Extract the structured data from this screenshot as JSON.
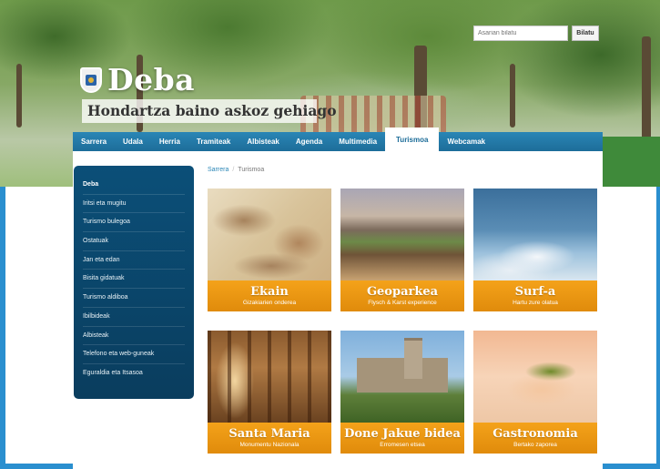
{
  "search": {
    "placeholder": "Asarian bilatu",
    "button_label": "Bilatu"
  },
  "logo": {
    "text": "Deba",
    "tagline": "Hondartza baino askoz gehiago"
  },
  "nav": {
    "items": [
      {
        "label": "Sarrera"
      },
      {
        "label": "Udala"
      },
      {
        "label": "Herria"
      },
      {
        "label": "Tramiteak"
      },
      {
        "label": "Albisteak"
      },
      {
        "label": "Agenda"
      },
      {
        "label": "Multimedia"
      },
      {
        "label": "Turismoa"
      },
      {
        "label": "Webcamak"
      }
    ],
    "active": "Turismoa"
  },
  "breadcrumb": {
    "home": "Sarrera",
    "current": "Turismoa"
  },
  "sidebar": {
    "items": [
      {
        "label": "Deba"
      },
      {
        "label": "Iritsi eta mugitu"
      },
      {
        "label": "Turismo bulegoa"
      },
      {
        "label": "Ostatuak"
      },
      {
        "label": "Jan eta edan"
      },
      {
        "label": "Bisita gidatuak"
      },
      {
        "label": "Turismo aldiboa"
      },
      {
        "label": "Ibilbideak"
      },
      {
        "label": "Albisteak"
      },
      {
        "label": "Telefono eta web-guneak"
      },
      {
        "label": "Eguraldia eta Itsasoa"
      }
    ]
  },
  "cards": [
    {
      "title": "Ekain",
      "subtitle": "Gizakiarien onderea"
    },
    {
      "title": "Geoparkea",
      "subtitle": "Flysch & Karst experience"
    },
    {
      "title": "Surf-a",
      "subtitle": "Hartu zure olatua"
    },
    {
      "title": "Santa Maria",
      "subtitle": "Monumentu Nazionala"
    },
    {
      "title": "Done Jakue bidea",
      "subtitle": "Erromesen etsea"
    },
    {
      "title": "Gastronomia",
      "subtitle": "Bertako zaporea"
    }
  ],
  "colors": {
    "nav_blue": "#1d6d99",
    "sidebar_blue": "#0b4f78",
    "card_orange": "#f4a21a",
    "frame_blue": "#2a8fcf"
  }
}
